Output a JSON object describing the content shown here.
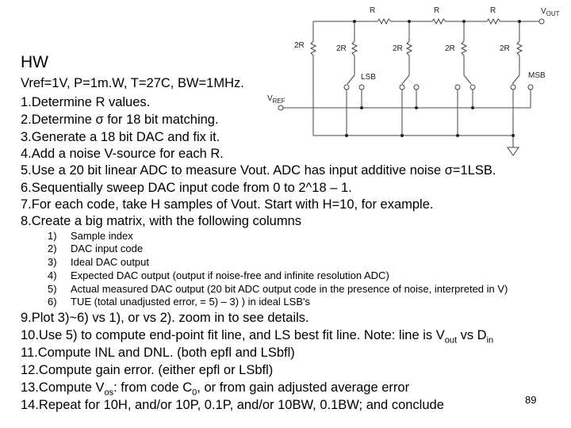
{
  "title": "HW",
  "params": "Vref=1V, P=1m.W, T=27C, BW=1MHz.",
  "items": [
    "1.Determine R values.",
    "2.Determine σ for 18 bit matching.",
    "3.Generate a 18 bit DAC and fix it.",
    "4.Add a noise V-source for each R.",
    "5.Use a 20 bit linear ADC to measure Vout. ADC has input additive noise σ=1LSB.",
    "6.Sequentially sweep DAC input code from 0 to 2^18 – 1.",
    "7.For each code, take H samples of Vout. Start with H=10, for example.",
    "8.Create a big matrix, with the following columns"
  ],
  "columns": [
    {
      "n": "1)",
      "t": "Sample index"
    },
    {
      "n": "2)",
      "t": "DAC input code"
    },
    {
      "n": "3)",
      "t": "Ideal DAC output"
    },
    {
      "n": "4)",
      "t": "Expected DAC output (output if noise-free and infinite resolution ADC)"
    },
    {
      "n": "5)",
      "t": "Actual measured DAC output (20 bit ADC output code in the presence of noise, interpreted in V)"
    },
    {
      "n": "6)",
      "t": "TUE (total unadjusted error, = 5) – 3) ) in ideal LSB's"
    }
  ],
  "items2": {
    "i9": "9.Plot 3)~6) vs 1), or vs 2). zoom in to see details.",
    "i10a": "10.Use 5) to compute end-point fit line, and LS best fit line. Note: line is V",
    "i10sub1": "out",
    "i10b": " vs D",
    "i10sub2": "in",
    "i11": "11.Compute INL and DNL. (both epfl and LSbfl)",
    "i12": "12.Compute gain error. (either epfl or LSbfl)",
    "i13a": "13.Compute V",
    "i13sub1": "os",
    "i13b": ": from code C",
    "i13sub2": "0",
    "i13c": ", or from gain adjusted average error",
    "i14": "14.Repeat for 10H, and/or 10P, 0.1P, and/or 10BW, 0.1BW; and conclude"
  },
  "page_number": "89",
  "circuit": {
    "r": "R",
    "r2": "2R",
    "vout": "V",
    "vout_sub": "OUT",
    "vref": "V",
    "vref_sub": "REF",
    "lsb": "LSB",
    "msb": "MSB"
  }
}
